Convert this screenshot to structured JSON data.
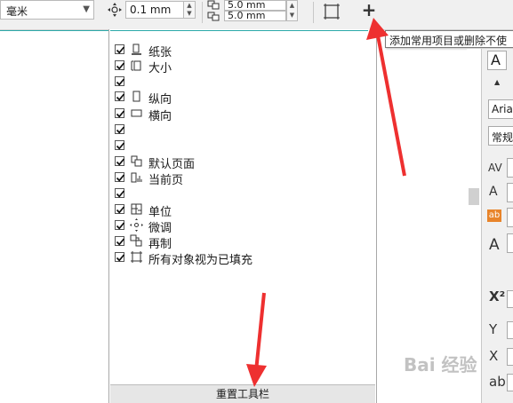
{
  "propbar": {
    "unit_value": "毫米",
    "nudge_value": "0.1 mm",
    "dup_x_value": "5.0 mm",
    "dup_y_value": "5.0 mm",
    "add_remove_label": "+"
  },
  "tooltip": {
    "text": "添加常用项目或删除不使"
  },
  "menu": {
    "items": [
      {
        "checked": true,
        "icon": "paper-icon",
        "label": "纸张"
      },
      {
        "checked": true,
        "icon": "size-icon",
        "label": "大小"
      },
      {
        "checked": true,
        "icon": "",
        "label": ""
      },
      {
        "checked": true,
        "icon": "portrait-icon",
        "label": "纵向"
      },
      {
        "checked": true,
        "icon": "landscape-icon",
        "label": "横向"
      },
      {
        "checked": true,
        "icon": "",
        "label": ""
      },
      {
        "checked": true,
        "icon": "",
        "label": ""
      },
      {
        "checked": true,
        "icon": "default-page-icon",
        "label": "默认页面"
      },
      {
        "checked": true,
        "icon": "current-page-icon",
        "label": "当前页"
      },
      {
        "checked": true,
        "icon": "",
        "label": ""
      },
      {
        "checked": true,
        "icon": "units-icon",
        "label": "单位"
      },
      {
        "checked": true,
        "icon": "nudge-icon",
        "label": "微调"
      },
      {
        "checked": true,
        "icon": "duplicate-icon",
        "label": "再制"
      },
      {
        "checked": true,
        "icon": "treat-filled-icon",
        "label": "所有对象视为已填充"
      }
    ],
    "reset_label": "重置工具栏"
  },
  "docker": {
    "font_name": "Arial",
    "font_style": "常规"
  },
  "watermark": "Bai 经验"
}
